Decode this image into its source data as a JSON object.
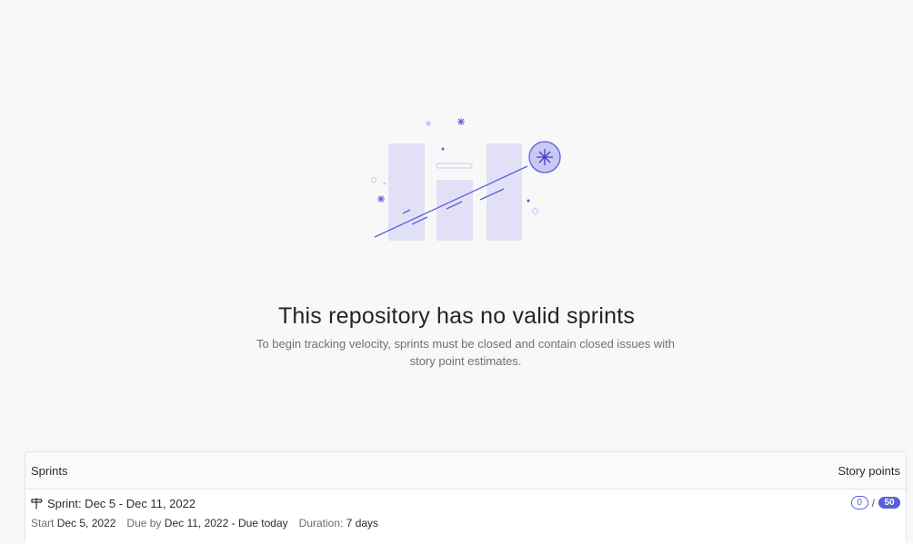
{
  "empty_state": {
    "title": "This repository has no valid sprints",
    "description": "To begin tracking velocity, sprints must be closed and contain closed issues with story point estimates.",
    "illustration_icon": "velocity-chart-illustration"
  },
  "sprints_panel": {
    "header_left": "Sprints",
    "header_right": "Story points",
    "rows": [
      {
        "icon": "sprint-signpost-icon",
        "title": "Sprint: Dec 5 - Dec 11, 2022",
        "start_label": "Start",
        "start_value": "Dec 5, 2022",
        "due_label": "Due by",
        "due_value": "Dec 11, 2022 - Due today",
        "duration_label": "Duration:",
        "duration_value": "7 days",
        "points_completed": "0",
        "points_separator": "/",
        "points_total": "50"
      }
    ]
  },
  "colors": {
    "accent": "#5a5fd6",
    "illustration_fill": "#e1e0f7",
    "background": "#f8f8f8"
  }
}
